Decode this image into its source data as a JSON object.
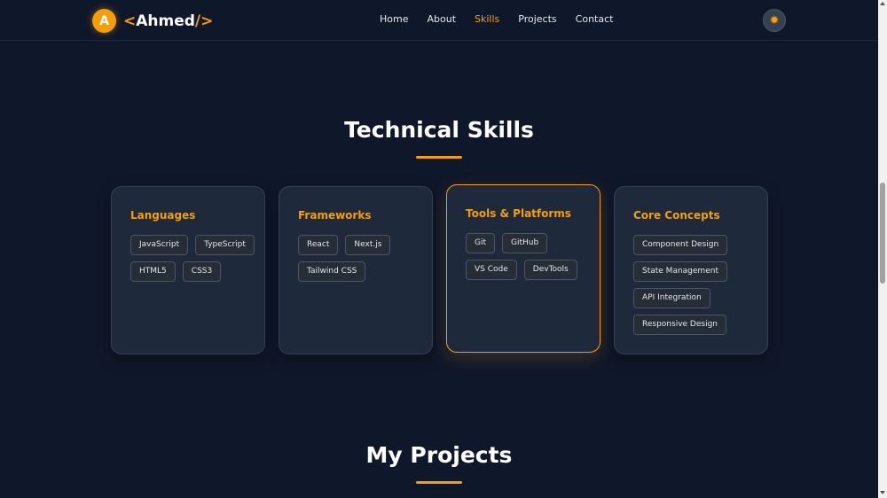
{
  "brand": {
    "badge_letter": "A",
    "open_bracket": "<",
    "name": "Ahmed",
    "close_bracket": "/>"
  },
  "nav": {
    "links": [
      {
        "label": "Home"
      },
      {
        "label": "About"
      },
      {
        "label": "Skills",
        "active": true
      },
      {
        "label": "Projects"
      },
      {
        "label": "Contact"
      }
    ],
    "theme_toggle_icon": "sun-icon",
    "theme_toggle_glyph": "✹"
  },
  "skills": {
    "title": "Technical Skills",
    "categories": [
      {
        "title": "Languages",
        "tags": [
          "JavaScript",
          "TypeScript",
          "HTML5",
          "CSS3"
        ]
      },
      {
        "title": "Frameworks",
        "tags": [
          "React",
          "Next.js",
          "Tailwind CSS"
        ]
      },
      {
        "title": "Tools & Platforms",
        "tags": [
          "Git",
          "GitHub",
          "VS Code",
          "DevTools"
        ],
        "highlighted": true
      },
      {
        "title": "Core Concepts",
        "tags": [
          "Component Design",
          "State Management",
          "API Integration",
          "Responsive Design"
        ]
      }
    ]
  },
  "projects": {
    "title": "My Projects"
  },
  "colors": {
    "background": "#0f172a",
    "card": "#1e293b",
    "accent": "#f59e0b",
    "text": "#e5e7eb"
  }
}
